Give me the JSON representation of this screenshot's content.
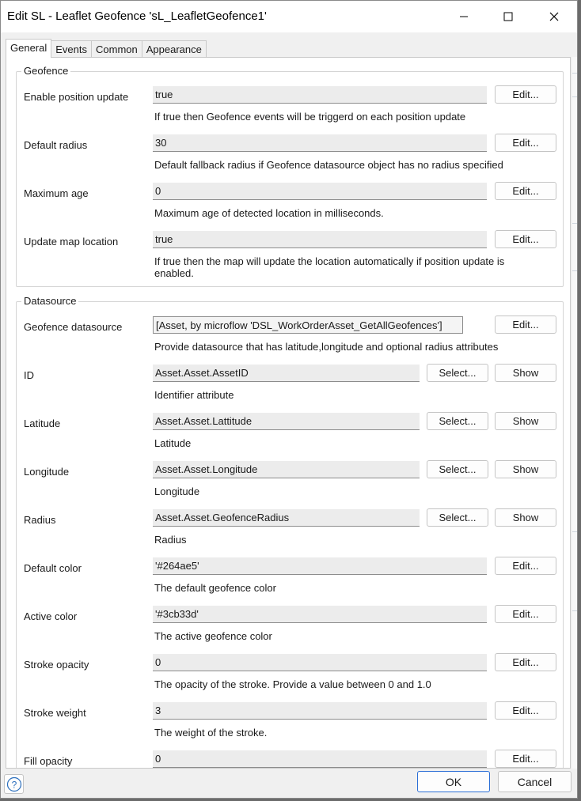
{
  "window": {
    "title": "Edit SL - Leaflet Geofence 'sL_LeafletGeofence1'"
  },
  "tabs": [
    {
      "label": "General",
      "active": true
    },
    {
      "label": "Events",
      "active": false
    },
    {
      "label": "Common",
      "active": false
    },
    {
      "label": "Appearance",
      "active": false
    }
  ],
  "geofence": {
    "group_label": "Geofence",
    "rows": [
      {
        "label": "Enable position update",
        "value": "true",
        "button": "Edit...",
        "description": "If true then Geofence events will be triggerd on each position update"
      },
      {
        "label": "Default radius",
        "value": "30",
        "button": "Edit...",
        "description": "Default fallback radius if Geofence datasource object has no radius specified"
      },
      {
        "label": "Maximum age",
        "value": "0",
        "button": "Edit...",
        "description": "Maximum age of detected location in milliseconds."
      },
      {
        "label": "Update map location",
        "value": "true",
        "button": "Edit...",
        "description": "If true then the map will update the location automatically if position update is enabled."
      }
    ]
  },
  "datasource": {
    "group_label": "Datasource",
    "rows": [
      {
        "label": "Geofence datasource",
        "value": "[Asset, by microflow 'DSL_WorkOrderAsset_GetAllGeofences']",
        "button": "Edit...",
        "description": "Provide datasource that has latitude,longitude and optional radius attributes"
      },
      {
        "label": "ID",
        "value": "Asset.Asset.AssetID",
        "select": "Select...",
        "show": "Show",
        "description": "Identifier attribute"
      },
      {
        "label": "Latitude",
        "value": "Asset.Asset.Lattitude",
        "select": "Select...",
        "show": "Show",
        "description": "Latitude"
      },
      {
        "label": "Longitude",
        "value": "Asset.Asset.Longitude",
        "select": "Select...",
        "show": "Show",
        "description": "Longitude"
      },
      {
        "label": "Radius",
        "value": "Asset.Asset.GeofenceRadius",
        "select": "Select...",
        "show": "Show",
        "description": "Radius"
      },
      {
        "label": "Default color",
        "value": "'#264ae5'",
        "button": "Edit...",
        "description": "The default geofence color"
      },
      {
        "label": "Active color",
        "value": "'#3cb33d'",
        "button": "Edit...",
        "description": "The active geofence color"
      },
      {
        "label": "Stroke opacity",
        "value": "0",
        "button": "Edit...",
        "description": "The opacity of the stroke. Provide a value between 0 and 1.0"
      },
      {
        "label": "Stroke weight",
        "value": "3",
        "button": "Edit...",
        "description": "The weight of the stroke."
      },
      {
        "label": "Fill opacity",
        "value": "0",
        "button": "Edit...",
        "description": ""
      }
    ]
  },
  "footer": {
    "ok": "OK",
    "cancel": "Cancel"
  },
  "colors": {
    "ok_border": "#2c6fd6",
    "help_icon": "#2a6ebd",
    "window_bg": "#f0f0f0"
  }
}
